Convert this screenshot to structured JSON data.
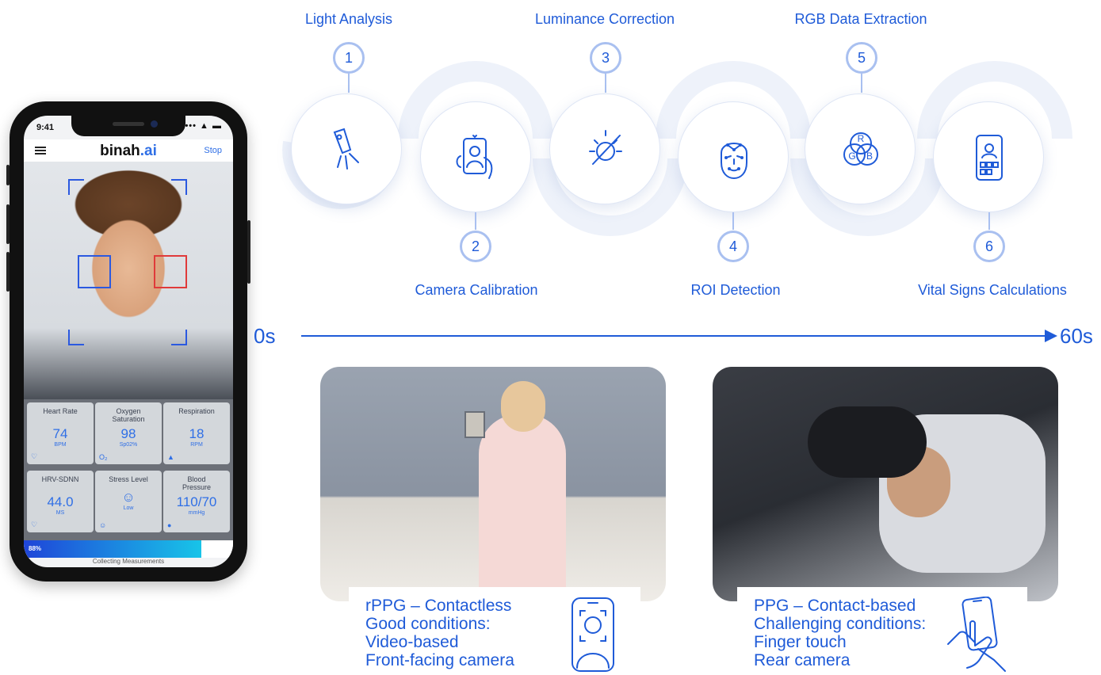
{
  "phone": {
    "status_time": "9:41",
    "status_icons": "••• ▲ ▬",
    "brand_name": "binah",
    "brand_suffix": ".ai",
    "stop_label": "Stop",
    "tiles": [
      {
        "label": "Heart Rate",
        "value": "74",
        "unit": "BPM",
        "icon": "heart-icon"
      },
      {
        "label": "Oxygen Saturation",
        "value": "98",
        "unit": "Sp02%",
        "icon": "oxygen-icon"
      },
      {
        "label": "Respiration",
        "value": "18",
        "unit": "RPM",
        "icon": "lungs-icon"
      },
      {
        "label": "HRV-SDNN",
        "value": "44.0",
        "unit": "MS",
        "icon": "heart-pulse-icon"
      },
      {
        "label": "Stress Level",
        "value": "☺",
        "unit": "Low",
        "icon": "smiley-icon"
      },
      {
        "label": "Blood Pressure",
        "value": "110/70",
        "unit": "mmHg",
        "icon": "drop-icon"
      }
    ],
    "progress_percent": "88%",
    "progress_value": 0.85,
    "progress_status": "Collecting Measurements"
  },
  "steps": [
    {
      "number": "1",
      "title": "Light Analysis",
      "icon": "flashlight-icon"
    },
    {
      "number": "2",
      "title": "Camera Calibration",
      "icon": "selfie-phone-icon"
    },
    {
      "number": "3",
      "title": "Luminance Correction",
      "icon": "luminance-icon"
    },
    {
      "number": "4",
      "title": "ROI Detection",
      "icon": "face-landmarks-icon"
    },
    {
      "number": "5",
      "title": "RGB Data Extraction",
      "icon": "rgb-venn-icon"
    },
    {
      "number": "6",
      "title": "Vital Signs Calculations",
      "icon": "phone-face-grid-icon"
    }
  ],
  "rgb_letters": {
    "r": "R",
    "g": "G",
    "b": "B"
  },
  "timeline": {
    "start": "0s",
    "end": "60s"
  },
  "cards": [
    {
      "lines": [
        "rPPG – Contactless",
        "Good conditions:",
        "Video-based",
        "Front-facing camera"
      ],
      "icon": "phone-face-icon"
    },
    {
      "lines": [
        "PPG – Contact-based",
        "Challenging conditions:",
        "Finger touch",
        "Rear camera"
      ],
      "icon": "hand-touch-phone-icon"
    }
  ],
  "colors": {
    "accent": "#1f5bd8",
    "ring": "#a9c0f0",
    "roi_blue": "#2b59e0",
    "roi_red": "#e03a3a"
  }
}
